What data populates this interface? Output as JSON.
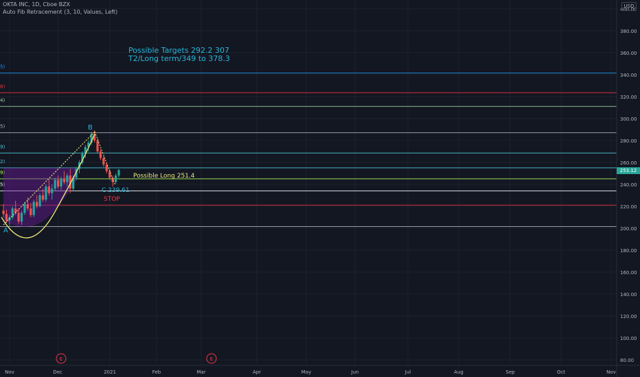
{
  "header": {
    "symbol_line": "OKTA INC, 1D, Cboe BZX",
    "indicator_line": "Auto Fib Retracement (3, 10, Values, Left)"
  },
  "axis": {
    "currency": "USD",
    "last_price": "253.12"
  },
  "colors": {
    "background": "#131722",
    "grid": "#1e222d",
    "up": "#26a69a",
    "down": "#ef5350",
    "cyan_text": "#29b6d8",
    "yellow_text": "#e8e57a",
    "red_text": "#f23645"
  },
  "annotations": {
    "targets_line1": "Possible Targets  292.2  307",
    "targets_line2": "T2/Long term/349 to 378.3",
    "possible_long": "Possible Long  251.4",
    "stop": "STOP",
    "point_a": "A",
    "point_b": "B",
    "point_c": "C 239.61",
    "earnings_1": "E",
    "earnings_2": "E"
  },
  "left_fib_labels": [
    "5)",
    "6)",
    "4)",
    "5)",
    "9)",
    "2)",
    "9)",
    "5)"
  ],
  "chart_data": {
    "type": "candlestick",
    "y_range": [
      75,
      408
    ],
    "y_ticks": [
      80,
      100,
      120,
      140,
      160,
      180,
      200,
      220,
      240,
      260,
      280,
      300,
      320,
      340,
      360,
      380,
      400
    ],
    "y_tick_labels": [
      "80.00",
      "100.00",
      "120.00",
      "140.00",
      "160.00",
      "180.00",
      "200.00",
      "220.00",
      "240.00",
      "260.00",
      "280.00",
      "300.00",
      "320.00",
      "340.00",
      "360.00",
      "380.00",
      "400.00"
    ],
    "x_labels": [
      "Nov",
      "Dec",
      "2021",
      "Feb",
      "Mar",
      "Apr",
      "May",
      "Jun",
      "Jul",
      "Aug",
      "Sep",
      "Oct",
      "Nov"
    ],
    "fib_levels": [
      {
        "value": 341.5,
        "color": "#2196f3"
      },
      {
        "value": 323.5,
        "color": "#f23645"
      },
      {
        "value": 311.0,
        "color": "#a5d6a7"
      },
      {
        "value": 287.0,
        "color": "#b2b5be"
      },
      {
        "value": 268.5,
        "color": "#4dd0e1"
      },
      {
        "value": 255.0,
        "color": "#4dd0e1"
      },
      {
        "value": 245.0,
        "color": "#b2ff59"
      },
      {
        "value": 234.0,
        "color": "#ffffff"
      },
      {
        "value": 221.0,
        "color": "#f23645"
      },
      {
        "value": 201.5,
        "color": "#b2b5be"
      }
    ],
    "candles": [
      {
        "o": 216,
        "h": 222,
        "l": 210,
        "c": 213
      },
      {
        "o": 213,
        "h": 217,
        "l": 205,
        "c": 207
      },
      {
        "o": 207,
        "h": 212,
        "l": 202,
        "c": 210
      },
      {
        "o": 210,
        "h": 220,
        "l": 208,
        "c": 218
      },
      {
        "o": 218,
        "h": 225,
        "l": 212,
        "c": 214
      },
      {
        "o": 214,
        "h": 218,
        "l": 204,
        "c": 206
      },
      {
        "o": 206,
        "h": 216,
        "l": 203,
        "c": 214
      },
      {
        "o": 214,
        "h": 224,
        "l": 212,
        "c": 222
      },
      {
        "o": 222,
        "h": 228,
        "l": 216,
        "c": 218
      },
      {
        "o": 218,
        "h": 223,
        "l": 210,
        "c": 212
      },
      {
        "o": 212,
        "h": 226,
        "l": 210,
        "c": 224
      },
      {
        "o": 224,
        "h": 230,
        "l": 218,
        "c": 220
      },
      {
        "o": 220,
        "h": 232,
        "l": 219,
        "c": 230
      },
      {
        "o": 230,
        "h": 236,
        "l": 224,
        "c": 226
      },
      {
        "o": 226,
        "h": 240,
        "l": 224,
        "c": 238
      },
      {
        "o": 238,
        "h": 244,
        "l": 230,
        "c": 232
      },
      {
        "o": 232,
        "h": 240,
        "l": 226,
        "c": 236
      },
      {
        "o": 236,
        "h": 246,
        "l": 234,
        "c": 244
      },
      {
        "o": 244,
        "h": 248,
        "l": 236,
        "c": 238
      },
      {
        "o": 238,
        "h": 247,
        "l": 235,
        "c": 245
      },
      {
        "o": 245,
        "h": 252,
        "l": 240,
        "c": 242
      },
      {
        "o": 242,
        "h": 250,
        "l": 238,
        "c": 248
      },
      {
        "o": 248,
        "h": 254,
        "l": 232,
        "c": 236
      },
      {
        "o": 236,
        "h": 248,
        "l": 234,
        "c": 246
      },
      {
        "o": 246,
        "h": 256,
        "l": 244,
        "c": 254
      },
      {
        "o": 254,
        "h": 262,
        "l": 250,
        "c": 260
      },
      {
        "o": 260,
        "h": 270,
        "l": 258,
        "c": 268
      },
      {
        "o": 268,
        "h": 276,
        "l": 264,
        "c": 274
      },
      {
        "o": 274,
        "h": 280,
        "l": 270,
        "c": 278
      },
      {
        "o": 278,
        "h": 288,
        "l": 276,
        "c": 286
      },
      {
        "o": 286,
        "h": 289,
        "l": 278,
        "c": 280
      },
      {
        "o": 280,
        "h": 282,
        "l": 268,
        "c": 270
      },
      {
        "o": 270,
        "h": 272,
        "l": 262,
        "c": 264
      },
      {
        "o": 264,
        "h": 266,
        "l": 256,
        "c": 258
      },
      {
        "o": 258,
        "h": 260,
        "l": 250,
        "c": 252
      },
      {
        "o": 252,
        "h": 254,
        "l": 244,
        "c": 246
      },
      {
        "o": 246,
        "h": 248,
        "l": 238,
        "c": 242
      },
      {
        "o": 242,
        "h": 250,
        "l": 240,
        "c": 248
      },
      {
        "o": 248,
        "h": 254,
        "l": 246,
        "c": 253
      }
    ]
  }
}
